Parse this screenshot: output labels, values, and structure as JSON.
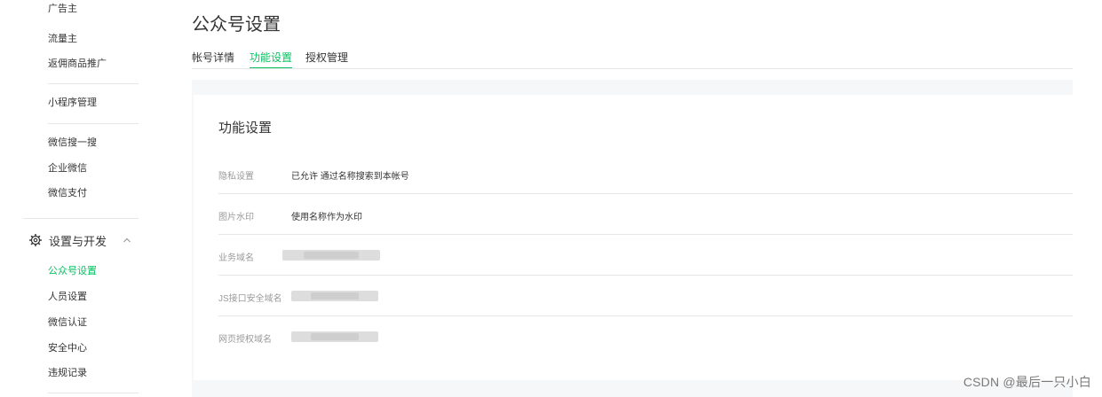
{
  "sidebar": {
    "top_items": [
      "广告主",
      "流量主",
      "返佣商品推广"
    ],
    "mini_program": "小程序管理",
    "wechat_items": [
      "微信搜一搜",
      "企业微信",
      "微信支付"
    ],
    "group_label": "设置与开发",
    "sub_items": [
      {
        "label": "公众号设置",
        "active": true
      },
      {
        "label": "人员设置",
        "active": false
      },
      {
        "label": "微信认证",
        "active": false
      },
      {
        "label": "安全中心",
        "active": false
      },
      {
        "label": "违规记录",
        "active": false
      }
    ]
  },
  "main": {
    "title": "公众号设置",
    "tabs": [
      {
        "label": "帐号详情",
        "active": false
      },
      {
        "label": "功能设置",
        "active": true
      },
      {
        "label": "授权管理",
        "active": false
      }
    ],
    "card": {
      "title": "功能设置",
      "rows": [
        {
          "label": "隐私设置",
          "value": "已允许 通过名称搜索到本帐号"
        },
        {
          "label": "图片水印",
          "value": "使用名称作为水印"
        },
        {
          "label": "业务域名",
          "value": ""
        },
        {
          "label": "JS接口安全域名",
          "value": ""
        },
        {
          "label": "网页授权域名",
          "value": ""
        }
      ]
    }
  },
  "watermark": "CSDN @最后一只小白",
  "colors": {
    "accent": "#07c160",
    "text": "#353535",
    "muted": "#9a9a9a",
    "divider": "#e7e7eb"
  }
}
